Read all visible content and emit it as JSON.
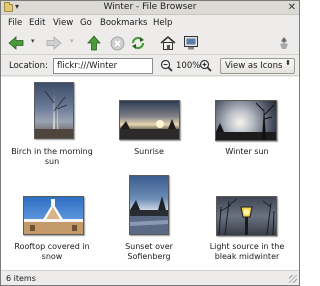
{
  "window": {
    "title": "Winter - File Browser",
    "title_chevron": "▾",
    "close_glyph": "✕"
  },
  "menubar": {
    "items": [
      "File",
      "Edit",
      "View",
      "Go",
      "Bookmarks",
      "Help"
    ]
  },
  "toolbar": {
    "icons": [
      "back-icon",
      "forward-icon",
      "up-icon",
      "stop-icon",
      "reload-icon",
      "home-icon",
      "computer-icon",
      "throbber-icon"
    ],
    "dropdown_glyph": "▾"
  },
  "location": {
    "label": "Location:",
    "value": "flickr:///Winter",
    "zoom": "100%",
    "view_mode": "View as Icons",
    "view_mode_glyph": "⬍"
  },
  "items": [
    {
      "name": "Birch in the morning sun"
    },
    {
      "name": "Sunrise"
    },
    {
      "name": "Winter sun"
    },
    {
      "name": "Rooftop covered in snow"
    },
    {
      "name": "Sunset over Sofienberg"
    },
    {
      "name": "Light source in the bleak midwinter"
    }
  ],
  "status": {
    "text": "6 items"
  },
  "colors": {
    "window_bg": "#edeceb",
    "content_bg": "#ffffff",
    "icon_green": "#4a9a3c",
    "stop_red": "#c8c8c8"
  }
}
